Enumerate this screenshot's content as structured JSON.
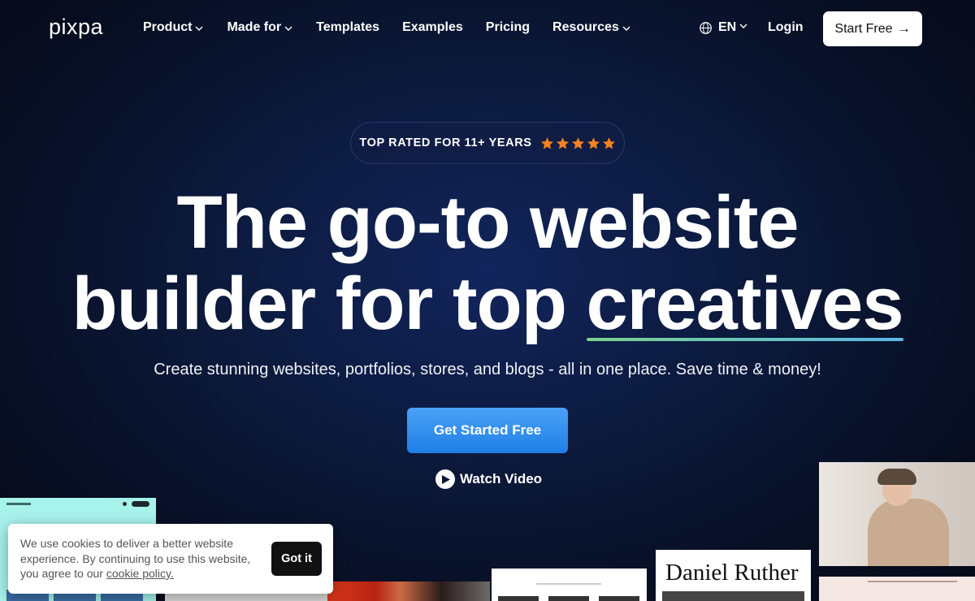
{
  "nav": {
    "logo": "pixpa",
    "items": [
      {
        "label": "Product",
        "dropdown": true
      },
      {
        "label": "Made for",
        "dropdown": true
      },
      {
        "label": "Templates",
        "dropdown": false
      },
      {
        "label": "Examples",
        "dropdown": false
      },
      {
        "label": "Pricing",
        "dropdown": false
      },
      {
        "label": "Resources",
        "dropdown": true
      }
    ],
    "language": "EN",
    "login": "Login",
    "start_free": "Start Free"
  },
  "badge": {
    "text": "TOP RATED FOR 11+ YEARS",
    "stars": 5,
    "star_color": "#f58220"
  },
  "hero": {
    "headline_line1": "The go-to website",
    "headline_line2_prefix": "builder for top ",
    "headline_highlight": "creatives",
    "subtitle": "Create stunning websites, portfolios, stores, and blogs - all in one place. Save time & money!",
    "cta": "Get Started Free",
    "watch_video": "Watch Video"
  },
  "thumbnails": {
    "daniel_title": "Daniel Ruther"
  },
  "cookie": {
    "text_before": "We use cookies to deliver a better website experience. By continuing to use this website, you agree to our ",
    "link": "cookie policy.",
    "button": "Got it"
  },
  "colors": {
    "background": "#0b1838",
    "cta": "#2d8cef",
    "underline_start": "#7ad28e",
    "underline_end": "#5fb7e6"
  }
}
